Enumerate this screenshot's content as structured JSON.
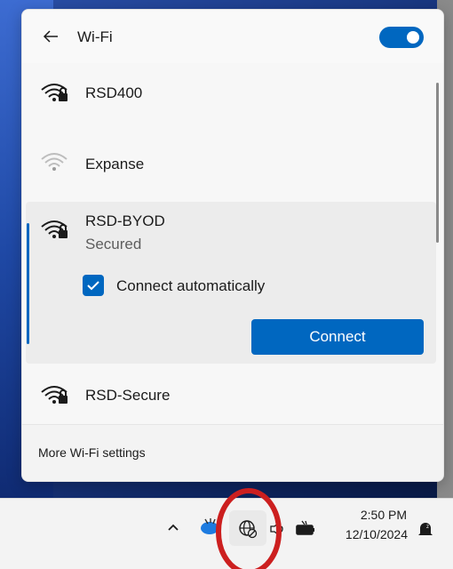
{
  "colors": {
    "accent": "#0067c0",
    "annotation": "#cc1f1f"
  },
  "header": {
    "title": "Wi-Fi",
    "back_icon": "back-arrow-icon",
    "toggle_state": "on"
  },
  "networks": [
    {
      "name": "RSD400",
      "icon": "wifi-secured-icon"
    },
    {
      "name": "Expanse",
      "icon": "wifi-weak-icon"
    },
    {
      "name": "RSD-BYOD",
      "status": "Secured",
      "icon": "wifi-secured-icon",
      "connect_automatically_label": "Connect automatically",
      "connect_automatically_checked": true,
      "connect_label": "Connect"
    },
    {
      "name": "RSD-Secure",
      "icon": "wifi-secured-icon"
    }
  ],
  "footer": {
    "more_settings": "More Wi-Fi settings"
  },
  "taskbar": {
    "icons": [
      "chevron-up-icon",
      "onedrive-icon",
      "network-globe-icon",
      "volume-icon",
      "battery-icon",
      "notification-icon"
    ],
    "time": "2:50 PM",
    "date": "12/10/2024"
  }
}
